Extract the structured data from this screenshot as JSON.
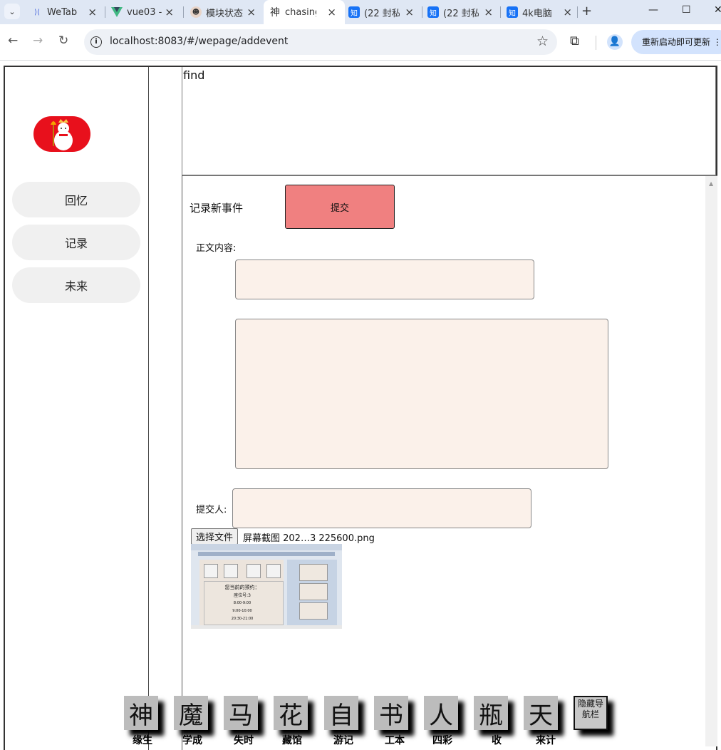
{
  "browser": {
    "tabs": [
      {
        "title": "WeTab",
        "icon": "wetab-icon"
      },
      {
        "title": "vue03 -",
        "icon": "vue-icon"
      },
      {
        "title": "模块状态",
        "icon": "avatar-icon"
      },
      {
        "title": "chasing",
        "icon": "shen-icon"
      },
      {
        "title": "(22 封私",
        "icon": "zhihu-icon"
      },
      {
        "title": "(22 封私",
        "icon": "zhihu-icon"
      },
      {
        "title": "4k电脑",
        "icon": "zhihu-icon"
      }
    ],
    "url": "localhost:8083/#/wepage/addevent",
    "update_label": "重新启动即可更新"
  },
  "sidebar": {
    "items": [
      {
        "label": "回忆"
      },
      {
        "label": "记录"
      },
      {
        "label": "未来"
      }
    ]
  },
  "find": {
    "text": "find"
  },
  "form": {
    "heading": "记录新事件",
    "submit_label": "提交",
    "content_label": "正文内容:",
    "submitter_label": "提交人:",
    "file_button": "选择文件",
    "file_name": "屏幕截图 202…3 225600.png"
  },
  "preview": {
    "title": "您当前的预约：",
    "seat": "座位号:3",
    "times": [
      "8:00-9:00",
      "9:00-10:00",
      "20:30-21:00"
    ]
  },
  "floating_nav": {
    "items": [
      {
        "glyph": "神",
        "label": "缘生"
      },
      {
        "glyph": "魔",
        "label": "学成"
      },
      {
        "glyph": "马",
        "label": "失时"
      },
      {
        "glyph": "花",
        "label": "藏馆"
      },
      {
        "glyph": "自",
        "label": "游记"
      },
      {
        "glyph": "书",
        "label": "工本"
      },
      {
        "glyph": "人",
        "label": "四彩"
      },
      {
        "glyph": "瓶",
        "label": "收"
      },
      {
        "glyph": "天",
        "label": "来计"
      }
    ],
    "hide_label": "隐藏导航栏"
  }
}
